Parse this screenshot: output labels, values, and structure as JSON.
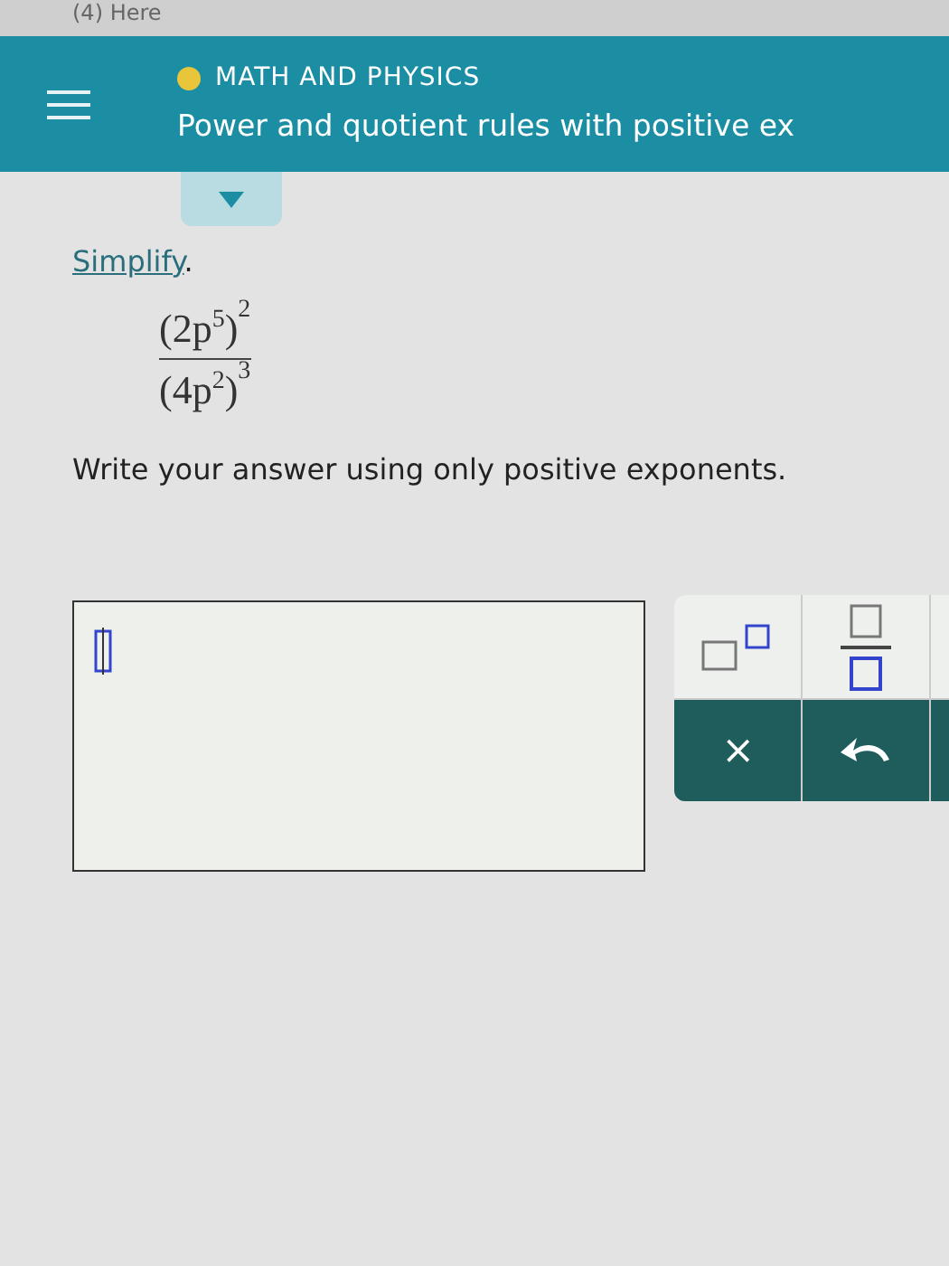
{
  "browser_tab": {
    "title": "(4) Here"
  },
  "header": {
    "category": "MATH AND PHYSICS",
    "title": "Power and quotient rules with positive ex"
  },
  "prompt": {
    "link": "Simplify",
    "punct": "."
  },
  "expression": {
    "open": "(",
    "close": ")",
    "numerator": {
      "base": "2p",
      "inner_exp": "5",
      "outer_exp": "2"
    },
    "denominator": {
      "base": "4p",
      "inner_exp": "2",
      "outer_exp": "3"
    }
  },
  "instruction": "Write your answer using only positive exponents.",
  "keypad": {
    "clear_key": "×"
  }
}
